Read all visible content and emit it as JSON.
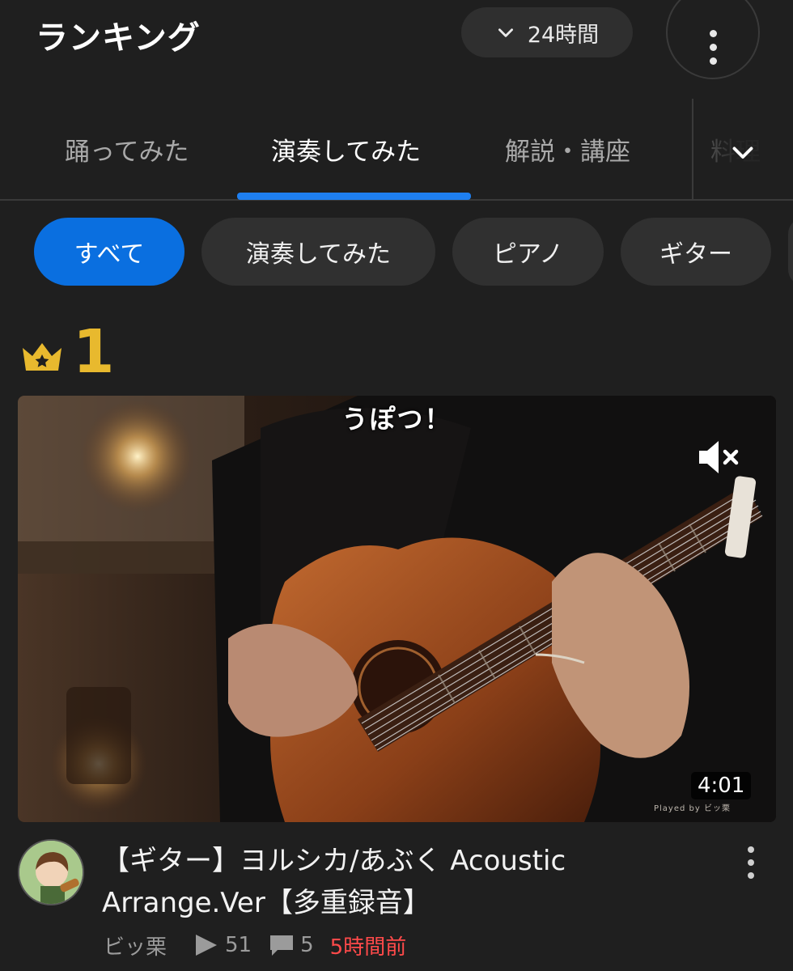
{
  "header": {
    "title": "ランキング",
    "period_label": "24時間"
  },
  "tabs": {
    "items": [
      "踊ってみた",
      "演奏してみた",
      "解説・講座",
      "料理"
    ],
    "active_index": 1
  },
  "chips": {
    "items": [
      "すべて",
      "演奏してみた",
      "ピアノ",
      "ギター"
    ],
    "active_index": 0
  },
  "ranking": {
    "rank": "1"
  },
  "video": {
    "caption": "うぽつ！",
    "duration": "4:01",
    "credit": "Played by ビッ栗",
    "title": "【ギター】ヨルシカ/あぶく Acoustic Arrange.Ver【多重録音】",
    "author": "ビッ栗",
    "views": "51",
    "comments": "5",
    "posted_ago": "5時間前",
    "avatar_text": "ビッ栗"
  },
  "colors": {
    "background": "#1f1f1f",
    "accent_blue": "#0a6fe0",
    "tab_underline": "#1e7ff0",
    "rank_gold": "#e8b92e",
    "posted_ago_red": "#ff4a4a"
  },
  "icons": {
    "period_toggle": "chevron-down-icon",
    "more": "more-vertical-icon",
    "tabs_toggle": "chevron-down-icon",
    "rank": "crown-icon",
    "mute": "volume-mute-icon",
    "views": "play-icon",
    "comments": "comment-icon"
  }
}
